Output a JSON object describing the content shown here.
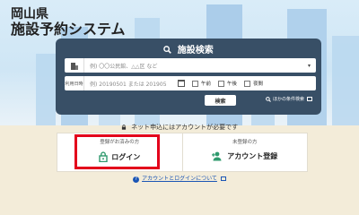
{
  "site": {
    "title_line1": "岡山県",
    "title_line2": "施設予約システム"
  },
  "search": {
    "heading": "施設検索",
    "facility_tag": "施設",
    "facility_placeholder": "例) 〇〇公民館、△△区 など",
    "date_tag": "利用日時",
    "date_placeholder": "例) 20190501 または 201905",
    "options": [
      {
        "label": "午前",
        "checked": false
      },
      {
        "label": "午後",
        "checked": false
      },
      {
        "label": "夜間",
        "checked": false
      }
    ],
    "submit_label": "検索",
    "other_conditions_label": "ほかの条件検索"
  },
  "notice": "ネット申込にはアカウントが必要です",
  "login": {
    "label": "登録がお済みの方",
    "action": "ログイン"
  },
  "register": {
    "label": "未登録の方",
    "action": "アカウント登録"
  },
  "help_link": "アカウントとログインについて",
  "colors": {
    "panel": "#384f66",
    "highlight": "#e3001b",
    "accent_green": "#2f9a6e",
    "link": "#1a55b5"
  }
}
